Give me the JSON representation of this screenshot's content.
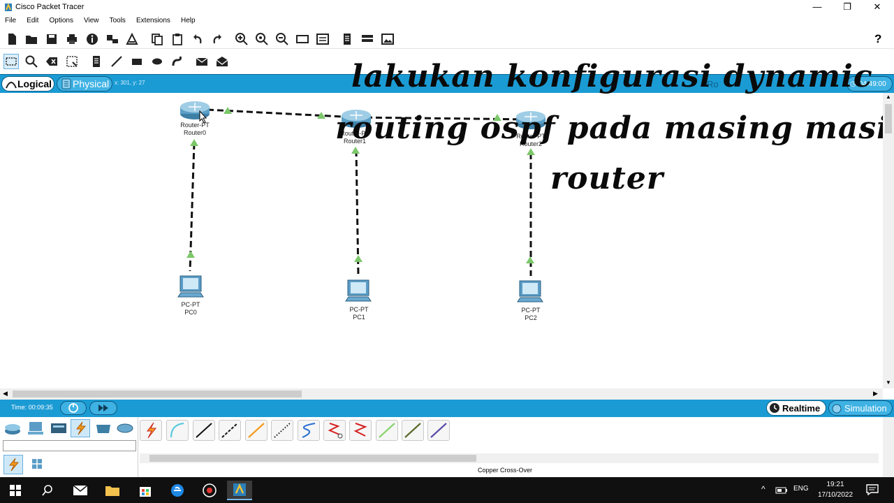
{
  "window": {
    "title": "Cisco Packet Tracer",
    "min": "—",
    "max": "❐",
    "close": "✕"
  },
  "menu": [
    "File",
    "Edit",
    "Options",
    "View",
    "Tools",
    "Extensions",
    "Help"
  ],
  "help_icon": "?",
  "workspace": {
    "logical_label": "Logical",
    "physical_label": "Physical",
    "coords": "x: 301, y: 27",
    "clock": "04:49:00",
    "root_partial": "Ro"
  },
  "overlay": {
    "line1": "lakukan konfigurasi  dynamic",
    "line2": "routing ospf pada masing masing",
    "line3": "router"
  },
  "devices": {
    "router0": {
      "model": "Router-PT",
      "name": "Router0"
    },
    "router1": {
      "model": "Router-PT",
      "name": "Router1"
    },
    "router2": {
      "model": "Router-PT",
      "name": "Router2"
    },
    "pc0": {
      "model": "PC-PT",
      "name": "PC0"
    },
    "pc1": {
      "model": "PC-PT",
      "name": "PC1"
    },
    "pc2": {
      "model": "PC-PT",
      "name": "PC2"
    }
  },
  "simbar": {
    "time": "Time: 00:09:35",
    "realtime": "Realtime",
    "simulation": "Simulation"
  },
  "device_panel": {
    "selected_cable_caption": "Copper Cross-Over"
  },
  "taskbar": {
    "lang": "ENG",
    "time": "19:21",
    "date": "17/10/2022"
  },
  "colors": {
    "accent": "#1b9bd4",
    "link": "#111111",
    "port_up": "#7cc76a"
  }
}
